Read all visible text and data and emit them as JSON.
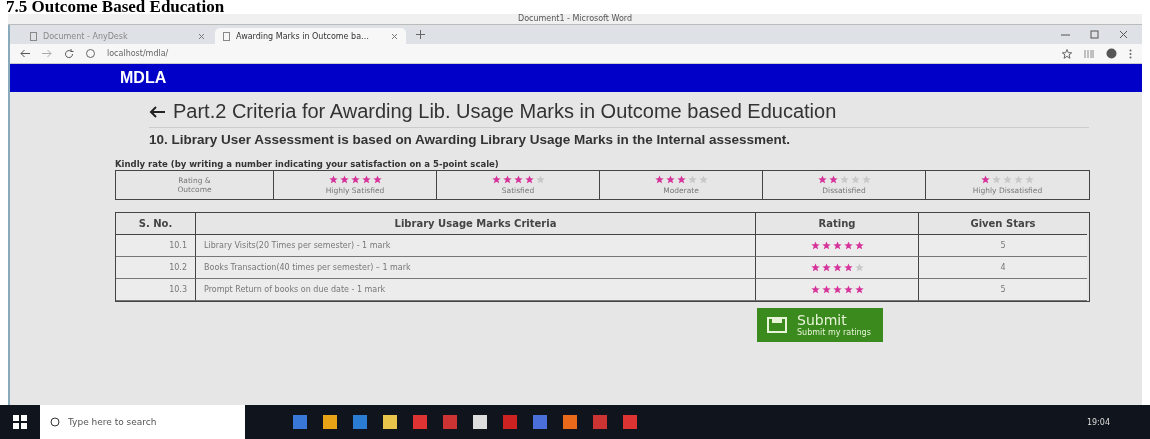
{
  "document_heading": "7.5  Outcome Based Education",
  "word_title": "Document1 - Microsoft Word",
  "browser": {
    "tabs": [
      {
        "label": "Document - AnyDesk",
        "selected": false
      },
      {
        "label": "Awarding Marks in Outcome ba…",
        "selected": true
      }
    ],
    "address": "localhost/mdla/"
  },
  "app_bar": {
    "title": "MDLA"
  },
  "page": {
    "title": "Part.2 Criteria for Awarding Lib. Usage Marks in Outcome based Education",
    "question": "10. Library User Assessment is based on Awarding Library Usage Marks in the Internal assessment.",
    "instruction": "Kindly rate (by writing a number indicating your satisfaction on a 5-point scale)",
    "legend": {
      "heading": "Rating & Outcome",
      "items": [
        {
          "stars": 5,
          "label": "Highly Satisfied"
        },
        {
          "stars": 4,
          "label": "Satisfied"
        },
        {
          "stars": 3,
          "label": "Moderate"
        },
        {
          "stars": 2,
          "label": "Dissatisfied"
        },
        {
          "stars": 1,
          "label": "Highly Dissatisfied"
        }
      ]
    },
    "table": {
      "columns": [
        "S. No.",
        "Library Usage Marks Criteria",
        "Rating",
        "Given Stars"
      ],
      "rows": [
        {
          "no": "10.1",
          "criteria": "Library Visits(20 Times per semester) - 1 mark",
          "stars": 5,
          "given": "5"
        },
        {
          "no": "10.2",
          "criteria": "Books Transaction(40 times per semester) – 1 mark",
          "stars": 4,
          "given": "4"
        },
        {
          "no": "10.3",
          "criteria": "Prompt Return of books on due date - 1 mark",
          "stars": 5,
          "given": "5"
        }
      ]
    },
    "submit": {
      "label": "Submit",
      "sublabel": "Submit my ratings"
    }
  },
  "taskbar": {
    "search_placeholder": "Type here to search",
    "clock": "19:04"
  }
}
